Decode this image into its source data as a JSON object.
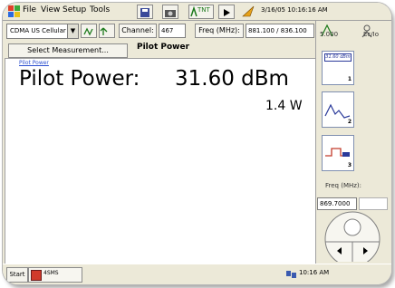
{
  "menu": {
    "items": [
      "File",
      "View",
      "Setup",
      "Tools"
    ],
    "wireless_label": "TNT",
    "datetime": "3/16/05 10:16:16 AM"
  },
  "toolbar": {
    "standard": "CDMA US Cellular",
    "channel_label": "Channel:",
    "channel_value": "467",
    "freq_label": "Freq (MHz):",
    "freq_value": "881.100 / 836.100",
    "right_value_1": "5.000",
    "right_value_2": "Ec/Io"
  },
  "tabs": {
    "select_measurement": "Select Measurement...",
    "active": "Pilot Power"
  },
  "main": {
    "breadcrumb": "Pilot Power",
    "label": "Pilot Power:",
    "value": "31.60 dBm",
    "sub_value": "1.4 W"
  },
  "right_panel": {
    "thumb1_value": "31.60 dBm",
    "thumb1_number": "1",
    "thumb2_number": "2",
    "thumb3_number": "3",
    "freq_label": "Freq (MHz):",
    "freq_value": "869.7000"
  },
  "taskbar": {
    "start": "Start",
    "task": "4SMS",
    "time": "10:16 AM"
  },
  "colors": {
    "chrome": "#ece9d8",
    "link": "#2b4fcf",
    "thumb_accent": "#2a3a9a"
  }
}
